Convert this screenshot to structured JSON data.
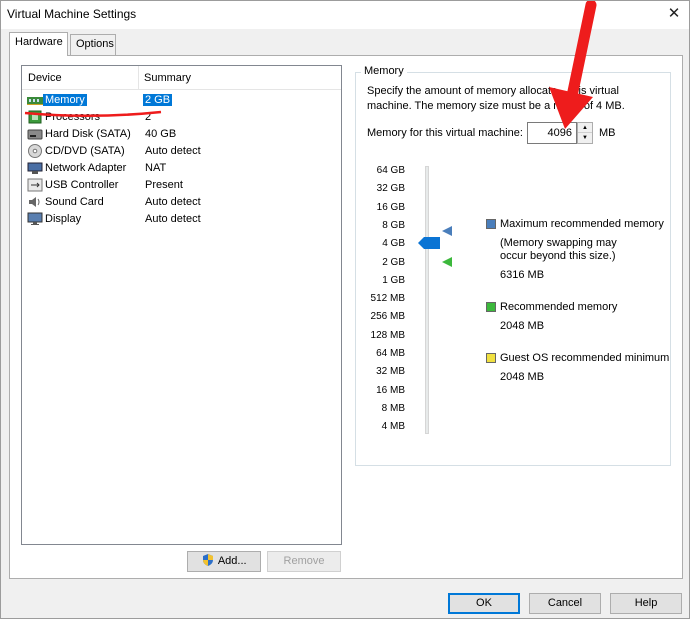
{
  "window": {
    "title": "Virtual Machine Settings",
    "close_glyph": "✕"
  },
  "tabs": [
    {
      "label": "Hardware"
    },
    {
      "label": "Options"
    }
  ],
  "device_list": {
    "headers": {
      "device": "Device",
      "summary": "Summary"
    },
    "rows": [
      {
        "device": "Memory",
        "summary": "2 GB",
        "icon": "memory-icon"
      },
      {
        "device": "Processors",
        "summary": "2",
        "icon": "processor-icon"
      },
      {
        "device": "Hard Disk (SATA)",
        "summary": "40 GB",
        "icon": "hard-disk-icon"
      },
      {
        "device": "CD/DVD (SATA)",
        "summary": "Auto detect",
        "icon": "cd-dvd-icon"
      },
      {
        "device": "Network Adapter",
        "summary": "NAT",
        "icon": "network-icon"
      },
      {
        "device": "USB Controller",
        "summary": "Present",
        "icon": "usb-icon"
      },
      {
        "device": "Sound Card",
        "summary": "Auto detect",
        "icon": "sound-icon"
      },
      {
        "device": "Display",
        "summary": "Auto detect",
        "icon": "display-icon"
      }
    ],
    "selected_index": 0
  },
  "buttons": {
    "add": "Add...",
    "remove": "Remove",
    "ok": "OK",
    "cancel": "Cancel",
    "help": "Help"
  },
  "memory": {
    "group_title": "Memory",
    "description_line1": "Specify the amount of memory allocate    this virtual",
    "description_line2": "machine. The memory size must be a mu     of 4 MB.",
    "field_label": "Memory for this virtual machine:",
    "value": "4096",
    "unit": "MB",
    "slider_ticks": [
      "64 GB",
      "32 GB",
      "16 GB",
      "8 GB",
      "4 GB",
      "2 GB",
      "1 GB",
      "512 MB",
      "256 MB",
      "128 MB",
      "64 MB",
      "32 MB",
      "16 MB",
      "8 MB",
      "4 MB"
    ],
    "slider_value": "4 GB",
    "legend": {
      "max_title": "Maximum recommended memory",
      "max_note_1": "(Memory swapping may",
      "max_note_2": "occur beyond this size.)",
      "max_value": "6316 MB",
      "rec_title": "Recommended memory",
      "rec_value": "2048 MB",
      "guest_title": "Guest OS recommended minimum",
      "guest_value": "2048 MB"
    }
  },
  "colors": {
    "selection": "#0078d7",
    "max_marker": "#4a7ebb",
    "rec_marker": "#3cb83c",
    "guest_marker": "#f0e040",
    "annotation": "#ee1c1c"
  }
}
